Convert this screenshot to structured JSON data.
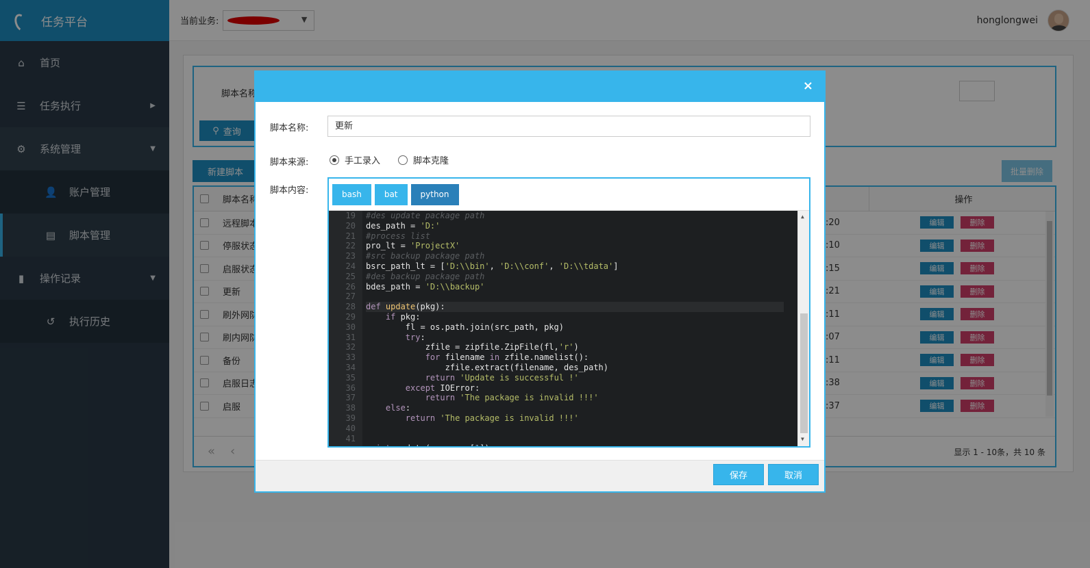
{
  "brand": {
    "title": "任务平台"
  },
  "nav": [
    {
      "icon": "home-icon",
      "label": "首页"
    },
    {
      "icon": "tasks-icon",
      "label": "任务执行"
    },
    {
      "icon": "gear-icon",
      "label": "系统管理"
    },
    {
      "icon": "user-icon",
      "label": "账户管理"
    },
    {
      "icon": "script-icon",
      "label": "脚本管理"
    },
    {
      "icon": "book-icon",
      "label": "操作记录"
    },
    {
      "icon": "history-icon",
      "label": "执行历史"
    }
  ],
  "topbar": {
    "biz_label": "当前业务:",
    "username": "honglongwei"
  },
  "query": {
    "name_label": "脚本名称",
    "query_btn": "查询"
  },
  "toolbar": {
    "new_btn": "新建脚本",
    "bulk_delete": "批量删除"
  },
  "table": {
    "col_name": "脚本名称",
    "col_ops": "操作",
    "edit_label": "编辑",
    "delete_label": "删除",
    "rows": [
      {
        "name": "远程脚本",
        "time": ":20"
      },
      {
        "name": "停服状态",
        "time": ":10"
      },
      {
        "name": "启服状态",
        "time": ":15"
      },
      {
        "name": "更新",
        "time": ":21"
      },
      {
        "name": "刷外网防",
        "time": ":11"
      },
      {
        "name": "刷内网防",
        "time": ":07"
      },
      {
        "name": "备份",
        "time": ":11"
      },
      {
        "name": "启服日志",
        "time": ":38"
      },
      {
        "name": "启服",
        "time": ":37"
      }
    ],
    "pager_info": "显示 1 - 10条，共 10 条"
  },
  "modal": {
    "close": "×",
    "name_label": "脚本名称:",
    "name_value": "更新",
    "source_label": "脚本来源:",
    "source_options": [
      "手工录入",
      "脚本克隆"
    ],
    "source_selected": "手工录入",
    "content_label": "脚本内容:",
    "langs": [
      "bash",
      "bat",
      "python"
    ],
    "active_lang": "python",
    "line_numbers": [
      "19",
      "20",
      "21",
      "22",
      "23",
      "24",
      "25",
      "26",
      "27",
      "28",
      "29",
      "30",
      "31",
      "32",
      "33",
      "34",
      "35",
      "36",
      "37",
      "38",
      "39",
      "40",
      "41"
    ],
    "save": "保存",
    "cancel": "取消"
  }
}
